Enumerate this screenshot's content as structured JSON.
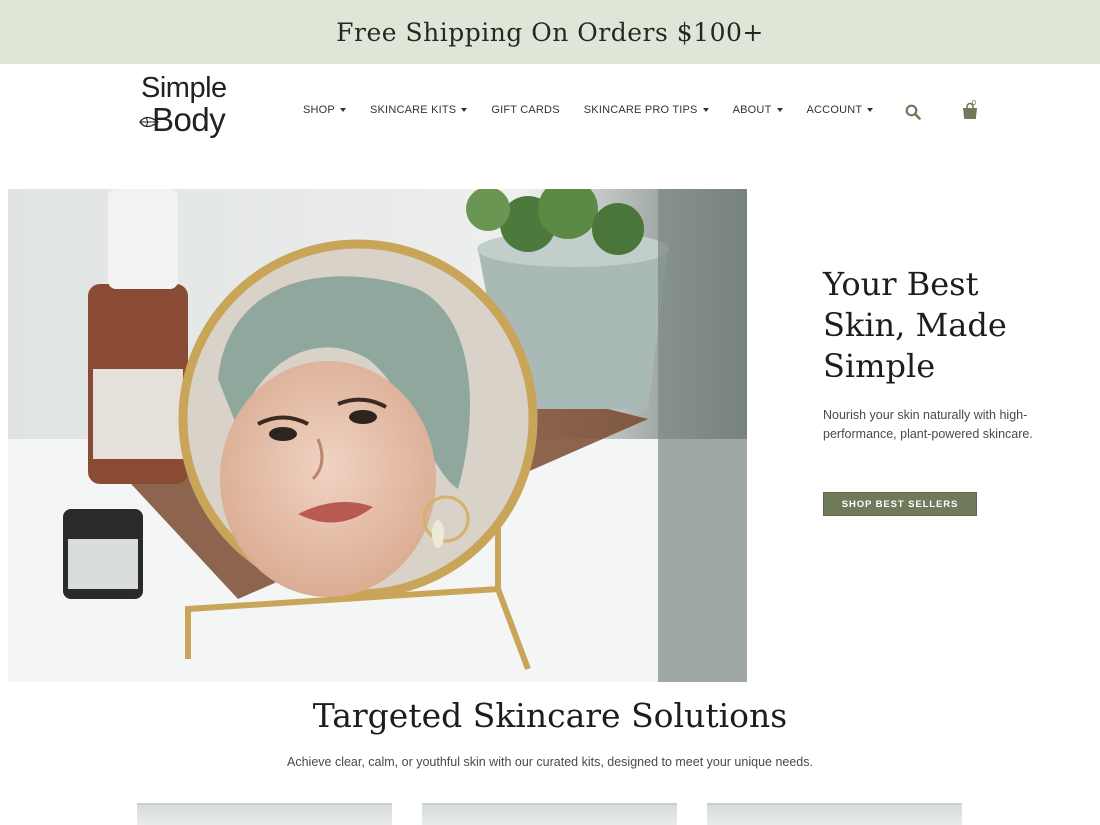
{
  "promo": {
    "text": "Free Shipping On Orders $100+"
  },
  "header": {
    "logo_line1": "Simple",
    "logo_line2": "Body",
    "nav": [
      {
        "label": "SHOP",
        "has_dropdown": true
      },
      {
        "label": "SKINCARE KITS",
        "has_dropdown": true
      },
      {
        "label": "GIFT CARDS",
        "has_dropdown": false
      },
      {
        "label": "SKINCARE PRO TIPS",
        "has_dropdown": true
      },
      {
        "label": "ABOUT",
        "has_dropdown": true
      },
      {
        "label": "ACCOUNT",
        "has_dropdown": true
      }
    ],
    "search_icon": "search-icon",
    "cart_icon": "shopping-bag-icon",
    "cart_count": "0"
  },
  "hero": {
    "title_lines": [
      "Your Best",
      "Skin, Made",
      "Simple"
    ],
    "subtitle": "Nourish your skin naturally with high-performance, plant-powered skincare.",
    "button": "SHOP BEST SELLERS"
  },
  "section": {
    "title": "Targeted Skincare Solutions",
    "subtitle": "Achieve clear, calm, or youthful skin with our curated kits, designed to meet your unique needs."
  },
  "colors": {
    "promo_bg": "#dfe6d7",
    "accent": "#6f7a5b",
    "icon": "#6f7a5b"
  }
}
